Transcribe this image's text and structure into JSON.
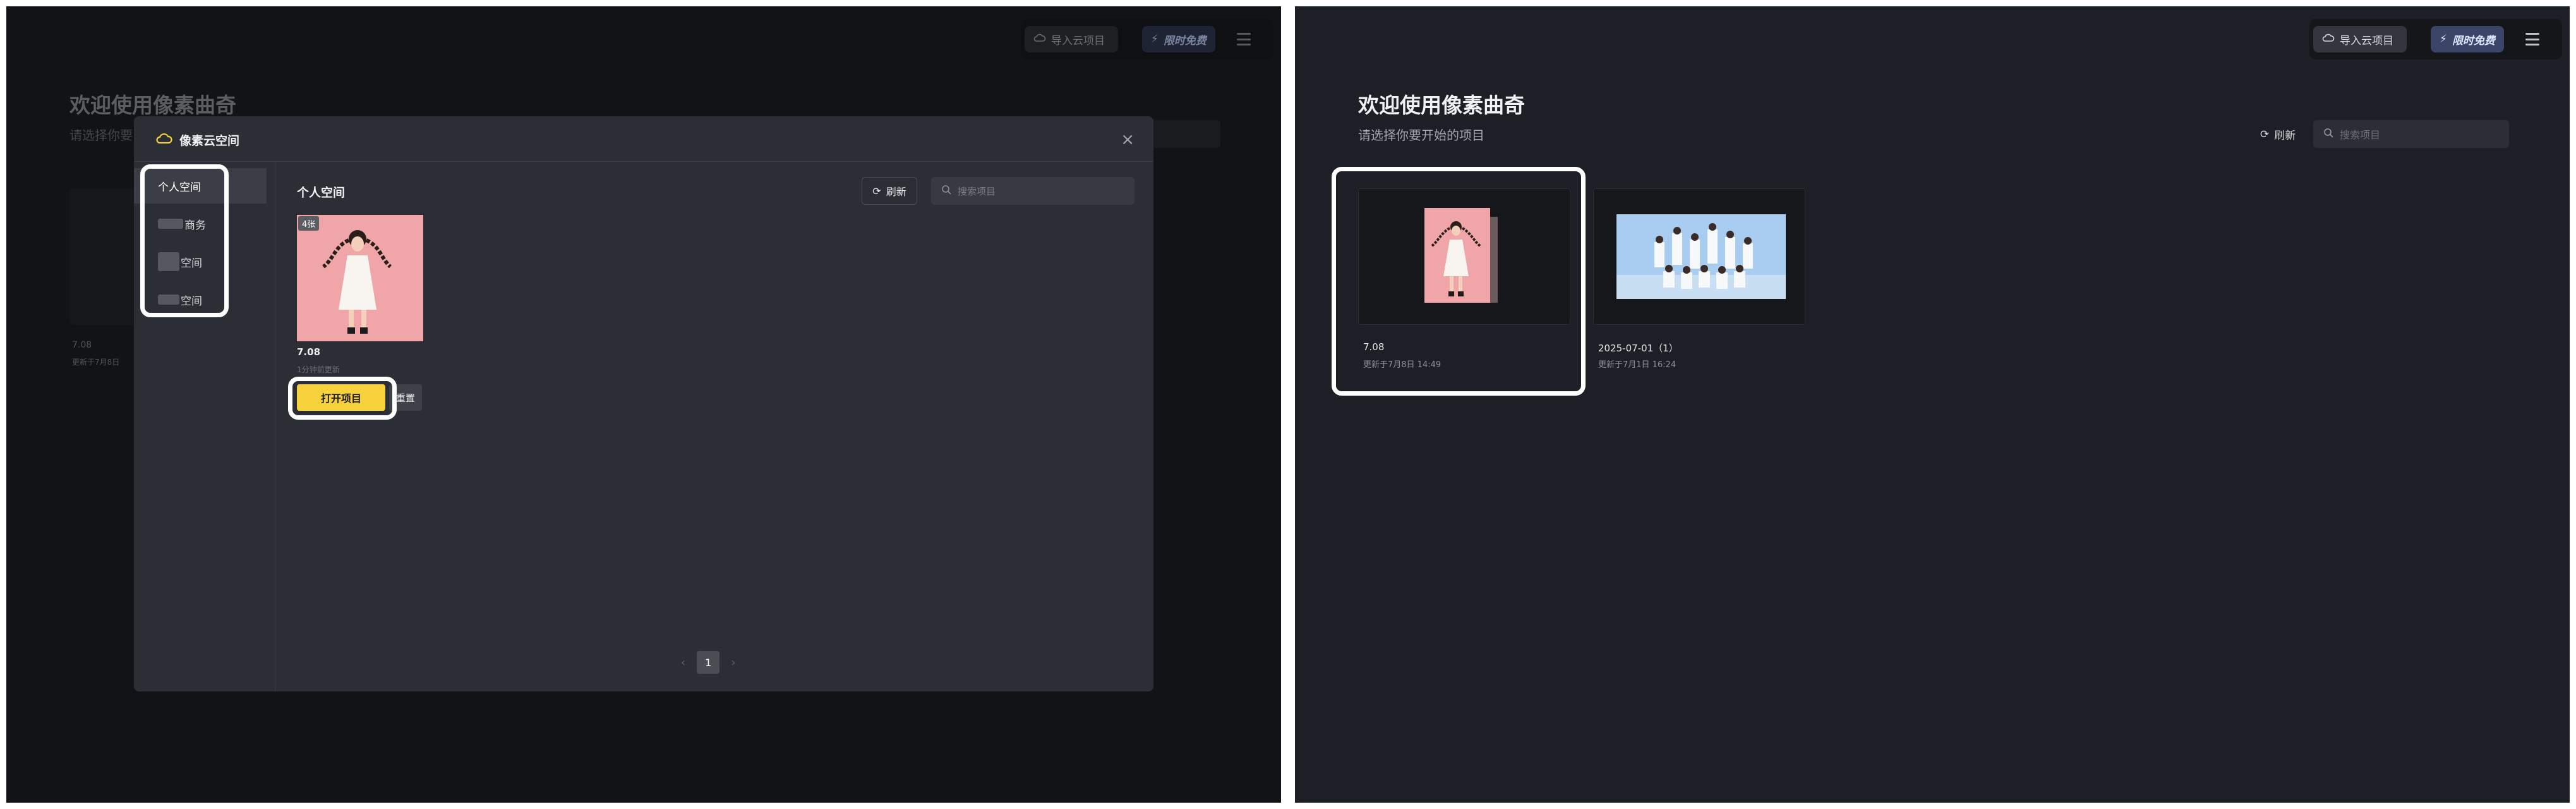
{
  "left": {
    "topbar": {
      "import_label": "导入云项目",
      "free_label": "限时免费"
    },
    "welcome": "欢迎使用像素曲奇",
    "subtitle": "请选择你要开始的项目",
    "subtitle_visible": "请选择你要",
    "bg_card": {
      "name": "7.08",
      "date": "更新于7月8日"
    },
    "modal": {
      "title": "像素云空间",
      "close": "×",
      "sidebar": [
        {
          "label": "个人空间",
          "active": true
        },
        {
          "label": "商务",
          "active": false
        },
        {
          "label": "空间",
          "active": false
        },
        {
          "label": "空间",
          "active": false
        }
      ],
      "section_title": "个人空间",
      "refresh_label": "刷新",
      "search_placeholder": "搜索项目",
      "card": {
        "badge": "4张",
        "name": "7.08",
        "subtitle": "1分钟前更新",
        "open_label": "打开项目",
        "reset_label": "重置"
      },
      "pagination": {
        "prev": "‹",
        "current": "1",
        "next": "›"
      }
    }
  },
  "right": {
    "topbar": {
      "import_label": "导入云项目",
      "free_label": "限时免费"
    },
    "welcome": "欢迎使用像素曲奇",
    "subtitle": "请选择你要开始的项目",
    "refresh_label": "刷新",
    "search_placeholder": "搜索项目",
    "projects": [
      {
        "name": "7.08",
        "date": "更新于7月8日 14:49"
      },
      {
        "name": "2025-07-01（1）",
        "date": "更新于7月1日 16:24"
      }
    ]
  },
  "colors": {
    "accent_yellow": "#f7d13c",
    "highlight": "#ffffff",
    "free_badge": "#3a4568"
  }
}
